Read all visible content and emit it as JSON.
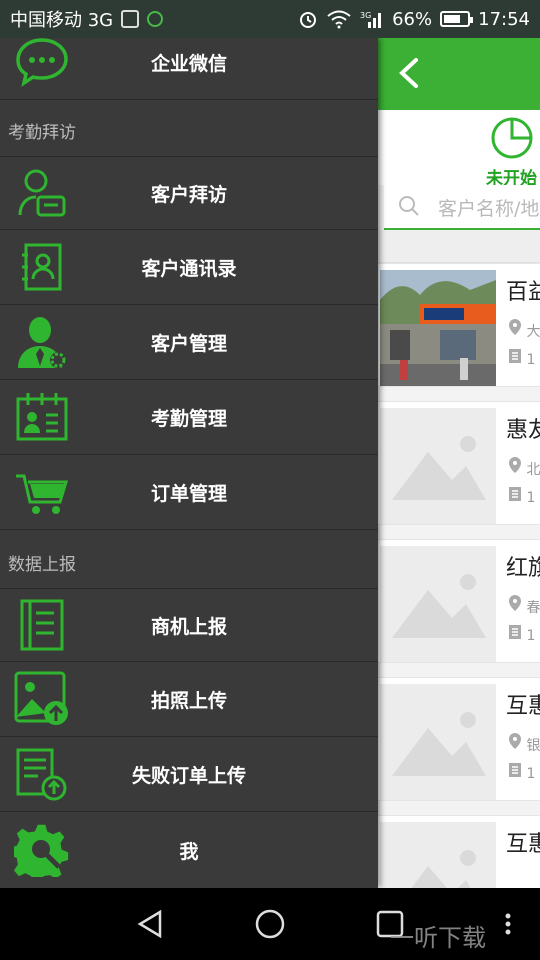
{
  "status_bar": {
    "carrier": "中国移动 3G",
    "battery_percent": "66%",
    "time": "17:54"
  },
  "drawer": {
    "top_item": {
      "label": "企业微信",
      "icon": "chat-icon"
    },
    "sections": [
      {
        "title": "考勤拜访",
        "items": [
          {
            "label": "客户拜访",
            "icon": "visit-icon"
          },
          {
            "label": "客户通讯录",
            "icon": "contacts-icon"
          },
          {
            "label": "客户管理",
            "icon": "customer-manage-icon"
          },
          {
            "label": "考勤管理",
            "icon": "attendance-icon"
          },
          {
            "label": "订单管理",
            "icon": "cart-icon"
          }
        ]
      },
      {
        "title": "数据上报",
        "items": [
          {
            "label": "商机上报",
            "icon": "report-icon"
          },
          {
            "label": "拍照上传",
            "icon": "photo-upload-icon"
          },
          {
            "label": "失败订单上传",
            "icon": "failed-order-upload-icon"
          },
          {
            "label": "我",
            "icon": "settings-icon"
          }
        ]
      }
    ]
  },
  "page": {
    "status_filter": "未开始",
    "search_placeholder": "客户名称/地",
    "cards": [
      {
        "title": "百益",
        "line1": "大",
        "line2": "1"
      },
      {
        "title": "惠友",
        "line1": "北",
        "line2": "1"
      },
      {
        "title": "红旗",
        "line1": "春",
        "line2": "1"
      },
      {
        "title": "互惠",
        "line1": "银",
        "line2": "1"
      },
      {
        "title": "互惠",
        "line1": "",
        "line2": ""
      }
    ]
  },
  "watermark": "一听下载",
  "colors": {
    "accent": "#3cb034",
    "drawer_bg": "#3a3a3a",
    "icon_green": "#2fb52f"
  }
}
